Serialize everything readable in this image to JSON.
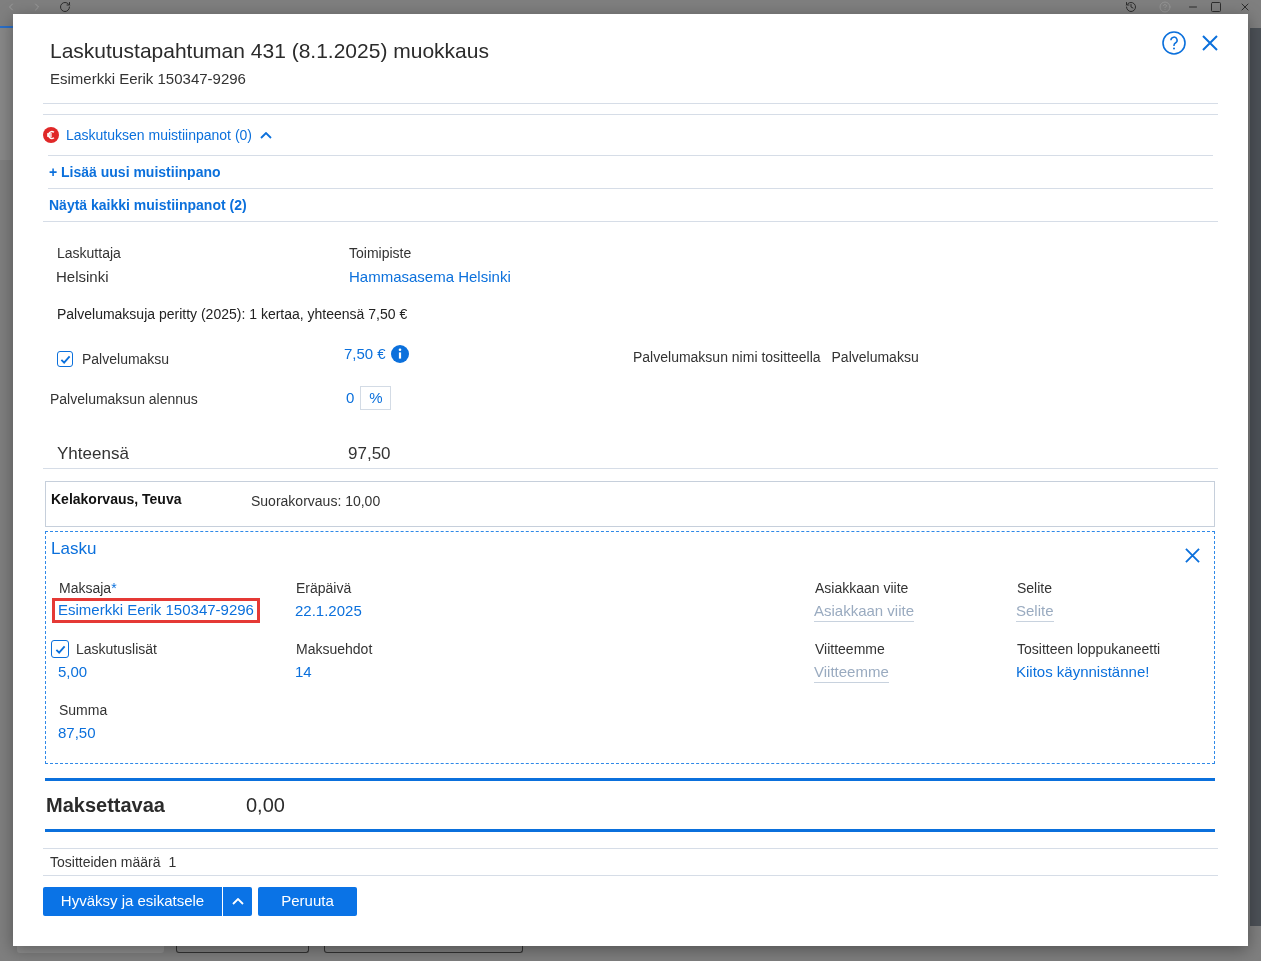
{
  "dialog": {
    "title": "Laskutustapahtuman 431 (8.1.2025) muokkaus",
    "subtitle": "Esimerkki Eerik 150347-9296"
  },
  "notes": {
    "label": "Laskutuksen muistiinpanot (0)",
    "expanded": true,
    "actions": [
      {
        "label": "+ Lisää uusi muistiinpano"
      },
      {
        "label": "Näytä kaikki muistiinpanot (2)"
      }
    ]
  },
  "billing": [
    {
      "label": "Laskuttaja",
      "value": "Helsinki",
      "kind": "text"
    },
    {
      "label": "Toimipiste",
      "value": "Hammasasema Helsinki",
      "kind": "link"
    }
  ],
  "fee_summary": "Palvelumaksuja peritty (2025): 1 kertaa, yhteensä 7,50 €",
  "service_fee": {
    "label": "Palvelumaksu",
    "checked": true,
    "amount": "7,50 €",
    "name_label": "Palvelumaksun nimi tositteella",
    "name_value": "Palvelumaksu"
  },
  "discount": {
    "label": "Palvelumaksun alennus",
    "value": "0",
    "unit": "%"
  },
  "total": {
    "label": "Yhteensä",
    "value": "97,50"
  },
  "reimbursement": {
    "title": "Kelakorvaus, Teuva",
    "detail": "Suorakorvaus: 10,00"
  },
  "invoice": {
    "title": "Lasku",
    "columns": [
      [
        {
          "kind": "value",
          "label": "Maksaja",
          "mark": "*",
          "value": "Esimerkki Eerik 150347-9296",
          "highlighted": true
        },
        {
          "kind": "checkbox",
          "label": "Laskutuslisät",
          "checked": true,
          "value": "5,00",
          "highlighted": false
        },
        {
          "kind": "value",
          "label": "Summa",
          "value": "87,50",
          "highlighted": false
        }
      ],
      [
        {
          "kind": "value",
          "label": "Eräpäivä",
          "value": "22.1.2025",
          "highlighted": false
        },
        {
          "kind": "value",
          "label": "Maksuehdot",
          "value": "14",
          "highlighted": false
        }
      ],
      [
        {
          "kind": "input",
          "label": "Asiakkaan viite",
          "placeholder": "Asiakkaan viite",
          "highlighted": false
        },
        {
          "kind": "input",
          "label": "Viitteemme",
          "placeholder": "Viitteemme",
          "highlighted": false
        }
      ],
      [
        {
          "kind": "input",
          "label": "Selite",
          "placeholder": "Selite",
          "highlighted": false
        },
        {
          "kind": "value",
          "label": "Tositteen loppukaneetti",
          "value": "Kiitos käynnistänne!",
          "highlighted": false
        }
      ]
    ]
  },
  "amount_due": {
    "label": "Maksettavaa",
    "value": "0,00"
  },
  "voucher_count": {
    "label": "Tositteiden määrä",
    "value": "1"
  },
  "buttons": [
    {
      "label": "Hyväksy ja esikatsele",
      "kind": "split"
    },
    {
      "label": "Peruuta",
      "kind": "plain"
    }
  ]
}
